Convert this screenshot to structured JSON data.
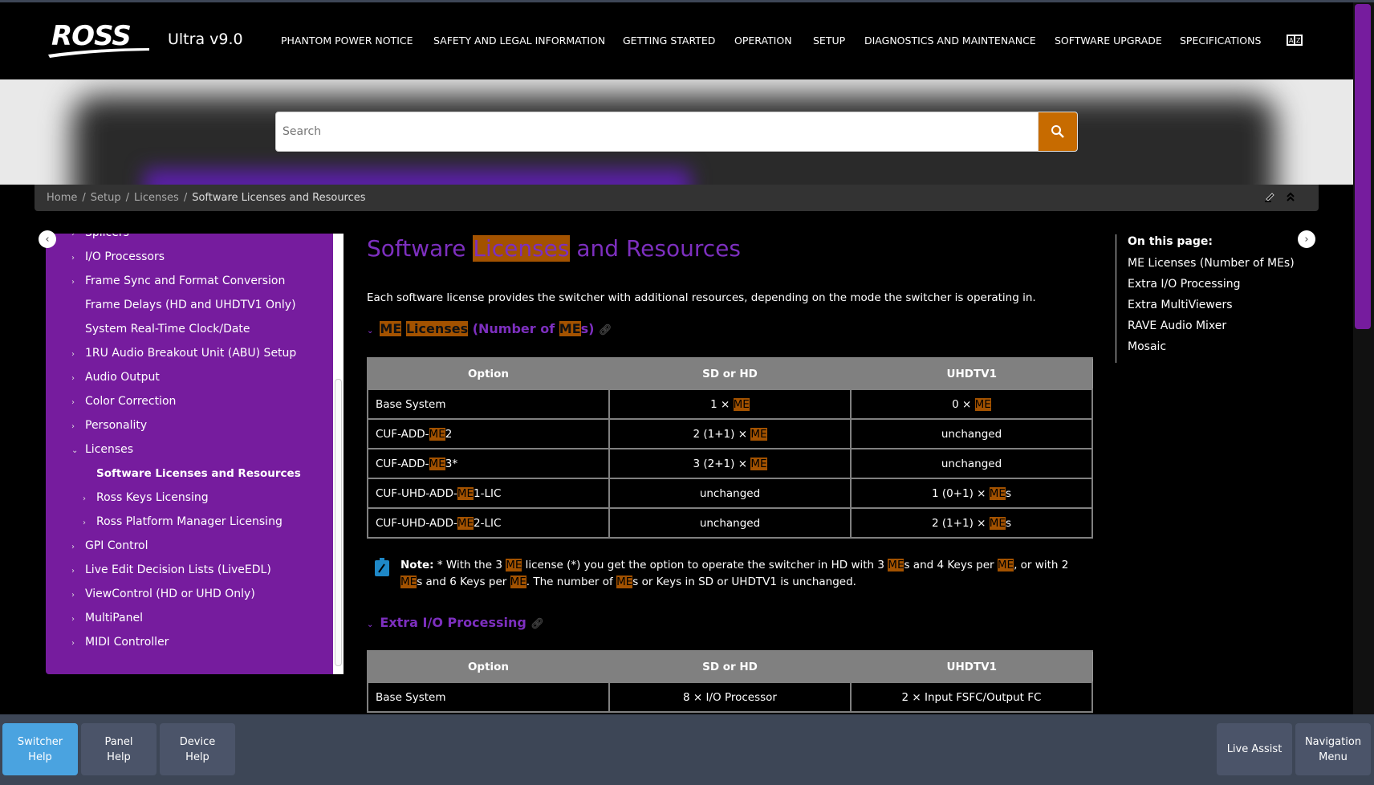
{
  "header": {
    "logo": "ROSS",
    "app_title": "Ultra v9.0",
    "nav": [
      "PHANTOM POWER NOTICE",
      "SAFETY AND LEGAL INFORMATION",
      "GETTING STARTED",
      "OPERATION",
      "SETUP",
      "DIAGNOSTICS AND MAINTENANCE",
      "SOFTWARE UPGRADE",
      "SPECIFICATIONS"
    ],
    "glossary_icon": "book-az-icon"
  },
  "search": {
    "placeholder": "Search",
    "icon": "search-icon"
  },
  "breadcrumb": [
    "Home",
    "Setup",
    "Licenses",
    "Software Licenses and Resources"
  ],
  "sidebar": {
    "items": [
      {
        "label": "Splicers",
        "level": 0,
        "chevron": ">"
      },
      {
        "label": "I/O Processors",
        "level": 0,
        "chevron": ">"
      },
      {
        "label": "Frame Sync and Format Conversion",
        "level": 0,
        "chevron": ">"
      },
      {
        "label": "Frame Delays (HD and UHDTV1 Only)",
        "level": 0,
        "chevron": ""
      },
      {
        "label": "System Real-Time Clock/Date",
        "level": 0,
        "chevron": ""
      },
      {
        "label": "1RU Audio Breakout Unit (ABU) Setup",
        "level": 0,
        "chevron": ">"
      },
      {
        "label": "Audio Output",
        "level": 0,
        "chevron": ">"
      },
      {
        "label": "Color Correction",
        "level": 0,
        "chevron": ">"
      },
      {
        "label": "Personality",
        "level": 0,
        "chevron": ">"
      },
      {
        "label": "Licenses",
        "level": 0,
        "chevron": "v"
      },
      {
        "label": "Software Licenses and Resources",
        "level": 1,
        "chevron": "",
        "active": true
      },
      {
        "label": "Ross Keys Licensing",
        "level": 1,
        "chevron": ">"
      },
      {
        "label": "Ross Platform Manager Licensing",
        "level": 1,
        "chevron": ">"
      },
      {
        "label": "GPI Control",
        "level": 0,
        "chevron": ">"
      },
      {
        "label": "Live Edit Decision Lists (LiveEDL)",
        "level": 0,
        "chevron": ">"
      },
      {
        "label": "ViewControl (HD or UHD Only)",
        "level": 0,
        "chevron": ">"
      },
      {
        "label": "MultiPanel",
        "level": 0,
        "chevron": ">"
      },
      {
        "label": "MIDI Controller",
        "level": 0,
        "chevron": ">"
      }
    ]
  },
  "main": {
    "title": [
      {
        "t": "Software "
      },
      {
        "t": "Licenses",
        "hl": true
      },
      {
        "t": " and Resources"
      }
    ],
    "intro": "Each software license provides the switcher with additional resources, depending on the mode the switcher is operating in.",
    "section1": [
      {
        "t": "ME",
        "hl": true
      },
      {
        "t": " "
      },
      {
        "t": "Licenses",
        "hl": true
      },
      {
        "t": " (Number of "
      },
      {
        "t": "ME",
        "hl": true
      },
      {
        "t": "s)"
      }
    ],
    "table1": {
      "headers": [
        "Option",
        "SD or HD",
        "UHDTV1"
      ],
      "rows": [
        [
          [
            {
              "t": "Base System"
            }
          ],
          [
            {
              "t": "1 × "
            },
            {
              "t": "ME",
              "hl": true
            }
          ],
          [
            {
              "t": "0 × "
            },
            {
              "t": "ME",
              "hl": true
            }
          ]
        ],
        [
          [
            {
              "t": "CUF-ADD-"
            },
            {
              "t": "ME",
              "hl": true
            },
            {
              "t": "2"
            }
          ],
          [
            {
              "t": "2 (1+1) × "
            },
            {
              "t": "ME",
              "hl": true
            }
          ],
          [
            {
              "t": "unchanged"
            }
          ]
        ],
        [
          [
            {
              "t": "CUF-ADD-"
            },
            {
              "t": "ME",
              "hl": true
            },
            {
              "t": "3*"
            }
          ],
          [
            {
              "t": "3 (2+1) × "
            },
            {
              "t": "ME",
              "hl": true
            }
          ],
          [
            {
              "t": "unchanged"
            }
          ]
        ],
        [
          [
            {
              "t": "CUF-UHD-ADD-"
            },
            {
              "t": "ME",
              "hl": true
            },
            {
              "t": "1-LIC"
            }
          ],
          [
            {
              "t": "unchanged"
            }
          ],
          [
            {
              "t": "1 (0+1) × "
            },
            {
              "t": "ME",
              "hl": true
            },
            {
              "t": "s"
            }
          ]
        ],
        [
          [
            {
              "t": "CUF-UHD-ADD-"
            },
            {
              "t": "ME",
              "hl": true
            },
            {
              "t": "2-LIC"
            }
          ],
          [
            {
              "t": "unchanged"
            }
          ],
          [
            {
              "t": "2 (1+1) × "
            },
            {
              "t": "ME",
              "hl": true
            },
            {
              "t": "s"
            }
          ]
        ]
      ]
    },
    "note": {
      "label": "Note:",
      "text": [
        {
          "t": " * With the 3 "
        },
        {
          "t": "ME",
          "hl": true
        },
        {
          "t": " license (*) you get the option to operate the switcher in HD with 3 "
        },
        {
          "t": "ME",
          "hl": true
        },
        {
          "t": "s and 4 Keys per "
        },
        {
          "t": "ME",
          "hl": true
        },
        {
          "t": ", or with 2 "
        },
        {
          "t": "ME",
          "hl": true
        },
        {
          "t": "s and 6 Keys per "
        },
        {
          "t": "ME",
          "hl": true
        },
        {
          "t": ". The number of "
        },
        {
          "t": "ME",
          "hl": true
        },
        {
          "t": "s or Keys in SD or UHDTV1 is unchanged."
        }
      ]
    },
    "section2": [
      {
        "t": "Extra I/O Processing"
      }
    ],
    "table2": {
      "headers": [
        "Option",
        "SD or HD",
        "UHDTV1"
      ],
      "rows": [
        [
          [
            {
              "t": "Base System"
            }
          ],
          [
            {
              "t": "8 × I/O Processor"
            }
          ],
          [
            {
              "t": "2 × Input FSFC/Output FC"
            }
          ]
        ]
      ]
    }
  },
  "toc": {
    "heading": "On this page:",
    "items": [
      "ME Licenses (Number of MEs)",
      "Extra I/O Processing",
      "Extra MultiViewers",
      "RAVE Audio Mixer",
      "Mosaic"
    ]
  },
  "bottom": {
    "left": [
      "Switcher\nHelp",
      "Panel\nHelp",
      "Device\nHelp"
    ],
    "right": [
      "Live Assist",
      "Navigation\nMenu"
    ],
    "active": 0
  },
  "colors": {
    "accent_purple": "#761c9e",
    "search_orange": "#c76b00",
    "highlight": "#a35200",
    "active_blue": "#4aa3e0"
  }
}
